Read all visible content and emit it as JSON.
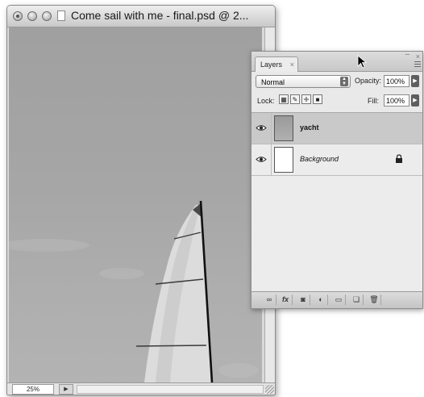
{
  "document": {
    "title": "Come sail with me - final.psd @ 2...",
    "zoom_level": "25%",
    "status_arrow": "▶"
  },
  "layers_panel": {
    "tab_label": "Layers",
    "tab_close": "×",
    "panel_close": "×",
    "panel_collapse": "–",
    "blend_mode": "Normal",
    "opacity_label": "Opacity:",
    "opacity_value": "100%",
    "lock_label": "Lock:",
    "fill_label": "Fill:",
    "fill_value": "100%",
    "layers": [
      {
        "name": "yacht",
        "selected": true,
        "visible": true
      },
      {
        "name": "Background",
        "selected": false,
        "visible": true,
        "locked": true
      }
    ],
    "footer_buttons": [
      "link-layers-icon",
      "fx-icon",
      "mask-icon",
      "adjustment-layer-icon",
      "group-folder-icon",
      "new-layer-icon",
      "trash-icon"
    ],
    "footer_fx": "fx"
  },
  "colors": {
    "sky": "#a6a6a6",
    "panel_bg": "#e9e9e9",
    "selected_row": "#c9c9c9"
  }
}
